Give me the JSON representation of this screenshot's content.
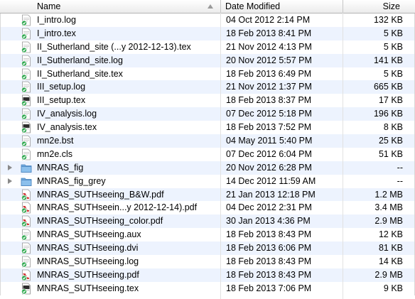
{
  "columns": {
    "name": "Name",
    "date": "Date Modified",
    "size": "Size"
  },
  "files": [
    {
      "name": "I_intro.log",
      "date": "04 Oct 2012 2:14 PM",
      "size": "132 KB",
      "icon": "text-doc-icon",
      "folder": false
    },
    {
      "name": "I_intro.tex",
      "date": "18 Feb 2013 8:41 PM",
      "size": "5 KB",
      "icon": "text-doc-icon",
      "folder": false
    },
    {
      "name": "II_Sutherland_site (...y 2012-12-13).tex",
      "date": "21 Nov 2012 4:13 PM",
      "size": "5 KB",
      "icon": "text-doc-icon",
      "folder": false
    },
    {
      "name": "II_Sutherland_site.log",
      "date": "20 Nov 2012 5:57 PM",
      "size": "141 KB",
      "icon": "text-doc-icon",
      "folder": false
    },
    {
      "name": "II_Sutherland_site.tex",
      "date": "18 Feb 2013 6:49 PM",
      "size": "5 KB",
      "icon": "text-doc-icon",
      "folder": false
    },
    {
      "name": "III_setup.log",
      "date": "21 Nov 2012 1:37 PM",
      "size": "665 KB",
      "icon": "text-doc-icon",
      "folder": false
    },
    {
      "name": "III_setup.tex",
      "date": "18 Feb 2013 8:37 PM",
      "size": "17 KB",
      "icon": "dark-doc-icon",
      "folder": false
    },
    {
      "name": "IV_analysis.log",
      "date": "07 Dec 2012 5:18 PM",
      "size": "196 KB",
      "icon": "text-doc-icon",
      "folder": false
    },
    {
      "name": "IV_analysis.tex",
      "date": "18 Feb 2013 7:52 PM",
      "size": "8 KB",
      "icon": "dark-doc-icon",
      "folder": false
    },
    {
      "name": "mn2e.bst",
      "date": "04 May 2011 5:40 PM",
      "size": "25 KB",
      "icon": "text-doc-icon",
      "folder": false
    },
    {
      "name": "mn2e.cls",
      "date": "07 Dec 2012 6:04 PM",
      "size": "51 KB",
      "icon": "text-doc-icon",
      "folder": false
    },
    {
      "name": "MNRAS_fig",
      "date": "20 Nov 2012 6:28 PM",
      "size": "--",
      "icon": "folder-icon",
      "folder": true
    },
    {
      "name": "MNRAS_fig_grey",
      "date": "14 Dec 2012 11:59 AM",
      "size": "--",
      "icon": "folder-icon",
      "folder": true
    },
    {
      "name": "MNRAS_SUTHseeing_B&W.pdf",
      "date": "21 Jan 2013 12:18 PM",
      "size": "1.2 MB",
      "icon": "pdf-icon",
      "folder": false
    },
    {
      "name": "MNRAS_SUTHseein...y 2012-12-14).pdf",
      "date": "04 Dec 2012 2:31 PM",
      "size": "3.4 MB",
      "icon": "pdf-icon",
      "folder": false
    },
    {
      "name": "MNRAS_SUTHseeing_color.pdf",
      "date": "30 Jan 2013 4:36 PM",
      "size": "2.9 MB",
      "icon": "pdf-icon",
      "folder": false
    },
    {
      "name": "MNRAS_SUTHseeing.aux",
      "date": "18 Feb 2013 8:43 PM",
      "size": "12 KB",
      "icon": "text-doc-icon",
      "folder": false
    },
    {
      "name": "MNRAS_SUTHseeing.dvi",
      "date": "18 Feb 2013 6:06 PM",
      "size": "81 KB",
      "icon": "text-doc-icon",
      "folder": false
    },
    {
      "name": "MNRAS_SUTHseeing.log",
      "date": "18 Feb 2013 8:43 PM",
      "size": "14 KB",
      "icon": "text-doc-icon",
      "folder": false
    },
    {
      "name": "MNRAS_SUTHseeing.pdf",
      "date": "18 Feb 2013 8:43 PM",
      "size": "2.9 MB",
      "icon": "pdf-icon",
      "folder": false
    },
    {
      "name": "MNRAS_SUTHseeing.tex",
      "date": "18 Feb 2013 7:06 PM",
      "size": "9 KB",
      "icon": "dark-doc-icon",
      "folder": false
    }
  ],
  "colors": {
    "accent": "#2fa84f",
    "folder": "#6fa9de",
    "pdf": "#cc2a2a",
    "stripe": "#edf3fe"
  }
}
